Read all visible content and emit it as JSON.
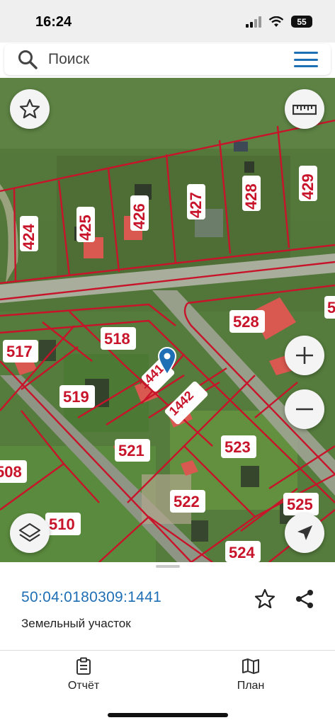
{
  "status": {
    "time": "16:24",
    "battery": "55"
  },
  "search": {
    "placeholder": "Поиск"
  },
  "map": {
    "parcels": [
      "424",
      "425",
      "426",
      "427",
      "428",
      "429",
      "528",
      "517",
      "518",
      "1441",
      "519",
      "1442",
      "521",
      "523",
      "508",
      "522",
      "510",
      "525",
      "524",
      "5"
    ],
    "colors": {
      "boundary": "#c8142a",
      "label_text": "#c8142a",
      "label_bg": "#ffffff",
      "marker": "#1f6fb5"
    }
  },
  "parcel": {
    "cadastral_number": "50:04:0180309:1441",
    "type": "Земельный участок"
  },
  "tabs": {
    "report_label": "Отчёт",
    "plan_label": "План"
  },
  "icons": {
    "search": "search-icon",
    "menu": "menu-icon",
    "favorite": "star-icon",
    "ruler": "ruler-icon",
    "zoom_in": "plus-icon",
    "zoom_out": "minus-icon",
    "layers": "layers-icon",
    "locate": "navigation-arrow-icon",
    "share": "share-icon",
    "report": "clipboard-icon",
    "plan": "map-icon"
  }
}
